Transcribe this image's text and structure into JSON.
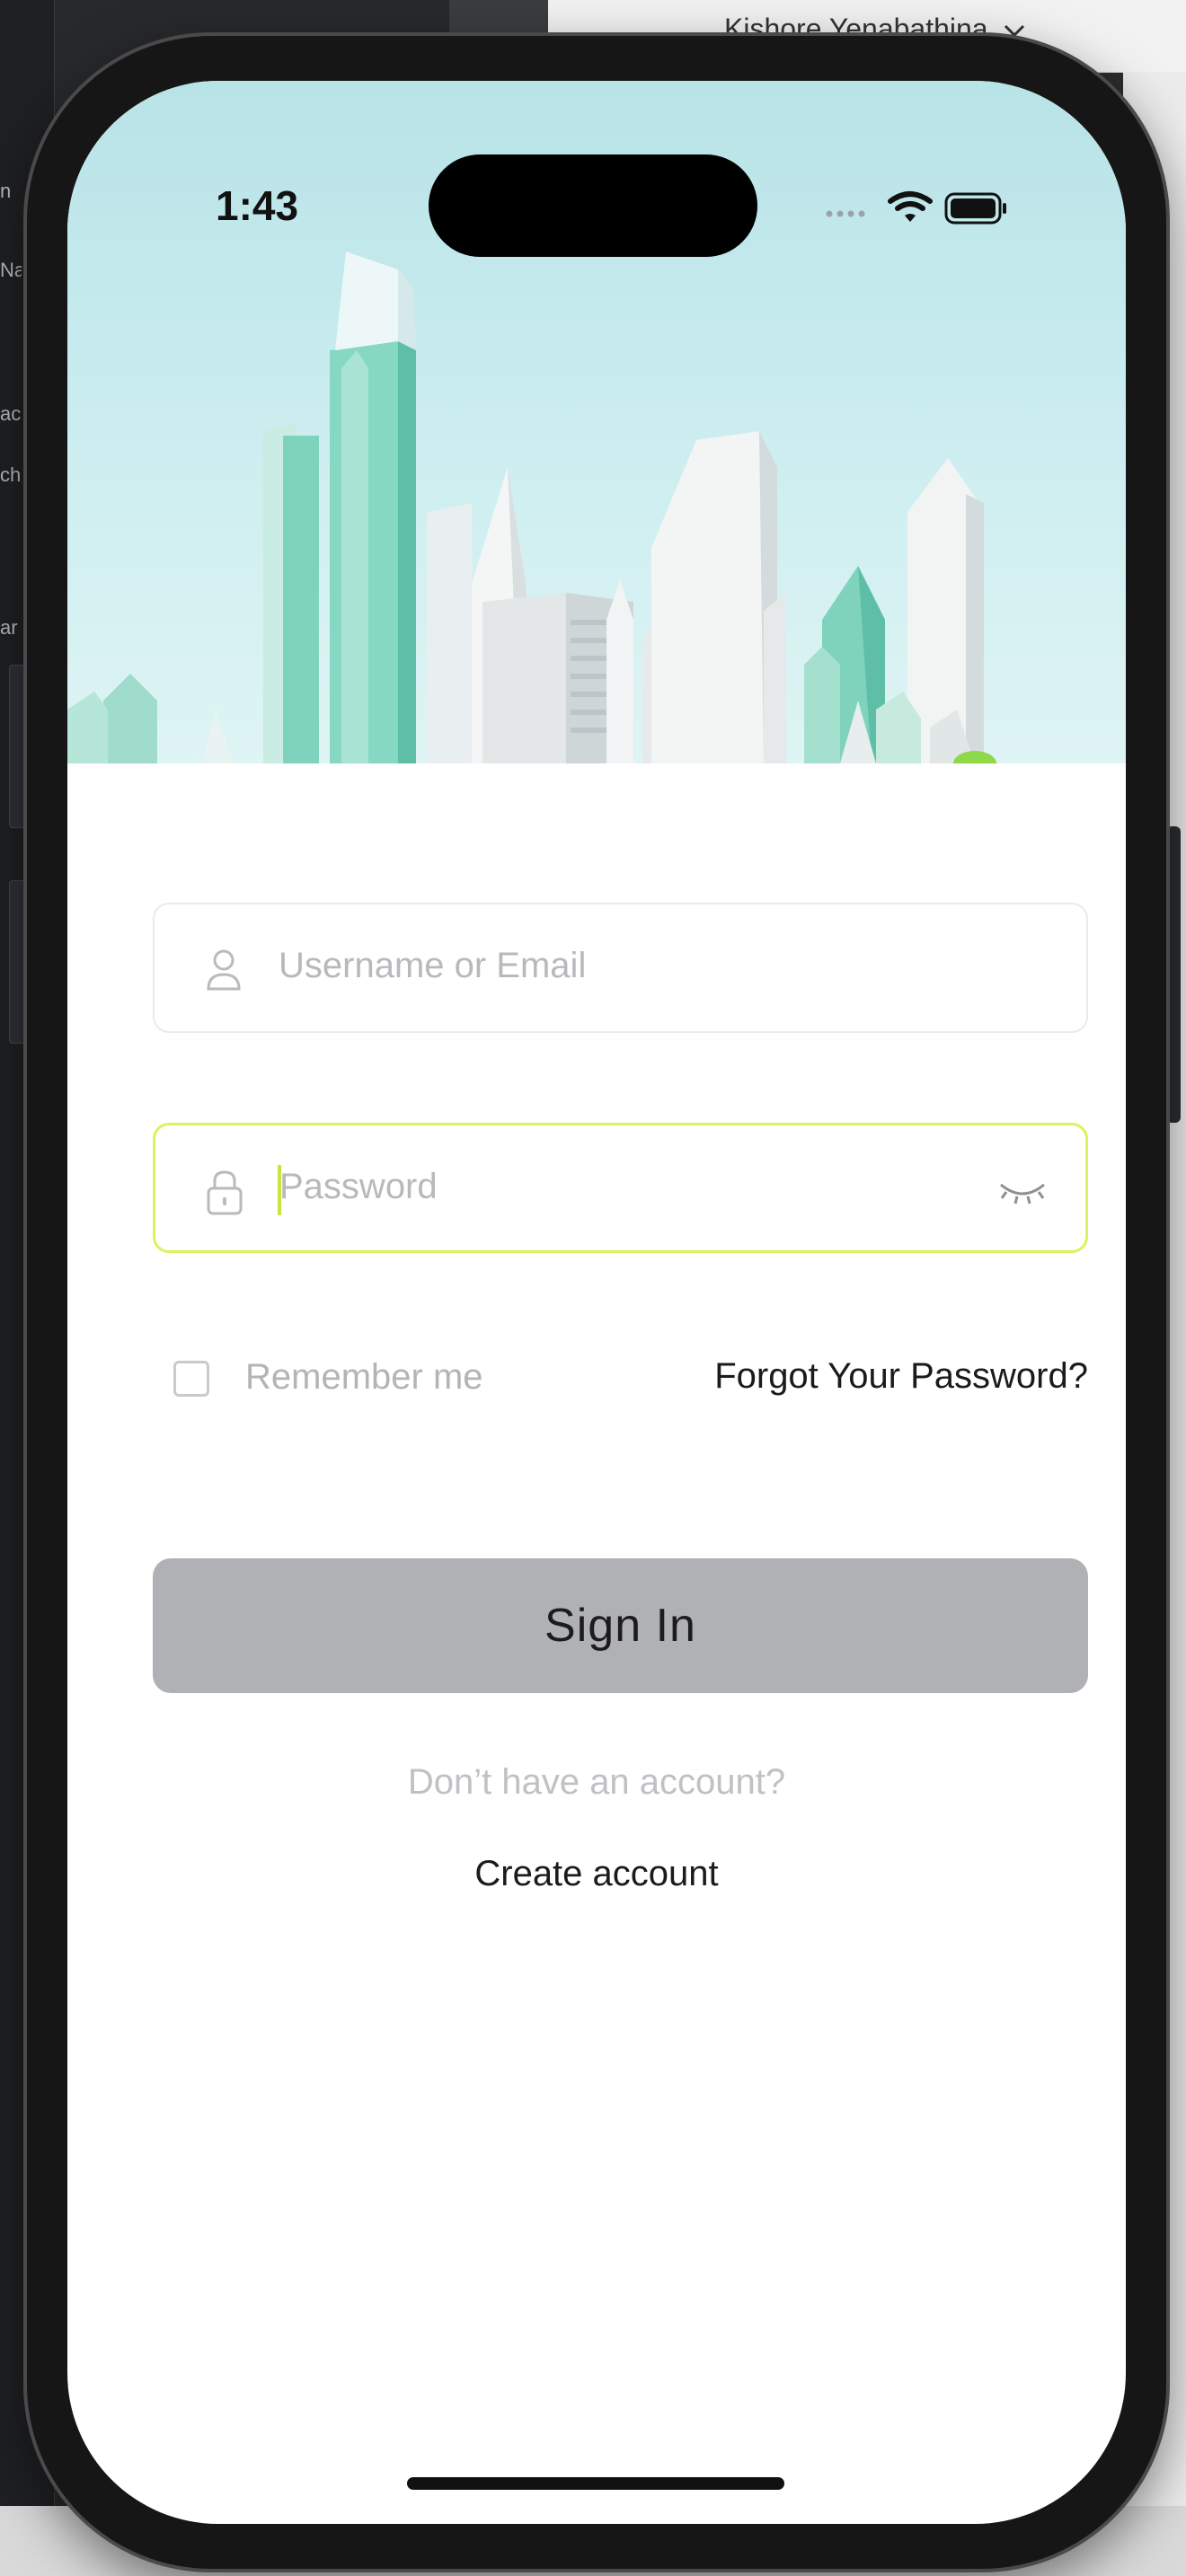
{
  "host": {
    "user_menu": "Kishore Yenabathina",
    "user_menu_chevron": "chevron-down-icon",
    "sidebar_fragments": [
      "n",
      "Na",
      "ac",
      "ch",
      "ar"
    ]
  },
  "status_bar": {
    "time": "1:43",
    "icons": [
      "cellular-signal-icon",
      "wifi-icon",
      "battery-icon"
    ]
  },
  "login": {
    "username": {
      "placeholder": "Username or Email",
      "value": "",
      "icon": "user-icon"
    },
    "password": {
      "placeholder": "Password",
      "value": "",
      "icon": "lock-icon",
      "toggle_icon": "eye-closed-icon",
      "focused": true
    },
    "remember_me": {
      "label": "Remember me",
      "checked": false
    },
    "forgot_password": "Forgot Your Password?",
    "sign_in": "Sign In",
    "no_account": "Don’t have an account?",
    "create_account": "Create account"
  },
  "colors": {
    "focus_border": "#dcf25e",
    "button_bg": "#b0b1b4",
    "hero_sky": "#b8e3e7",
    "building_teal": "#7fd3bd"
  }
}
